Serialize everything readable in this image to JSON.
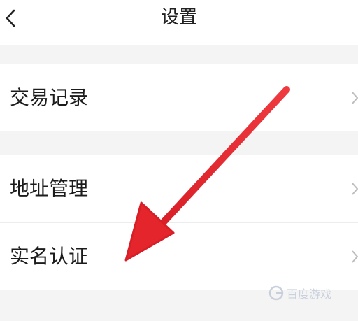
{
  "header": {
    "title": "设置",
    "back_icon": "chevron-left-icon"
  },
  "settings": {
    "items": [
      {
        "label": "交易记录",
        "icon": "chevron-right-icon"
      },
      {
        "label": "地址管理",
        "icon": "chevron-right-icon"
      },
      {
        "label": "实名认证",
        "icon": "chevron-right-icon"
      }
    ]
  },
  "annotation": {
    "arrow_color": "#e4252c"
  },
  "watermark": {
    "text": "百度游戏"
  }
}
